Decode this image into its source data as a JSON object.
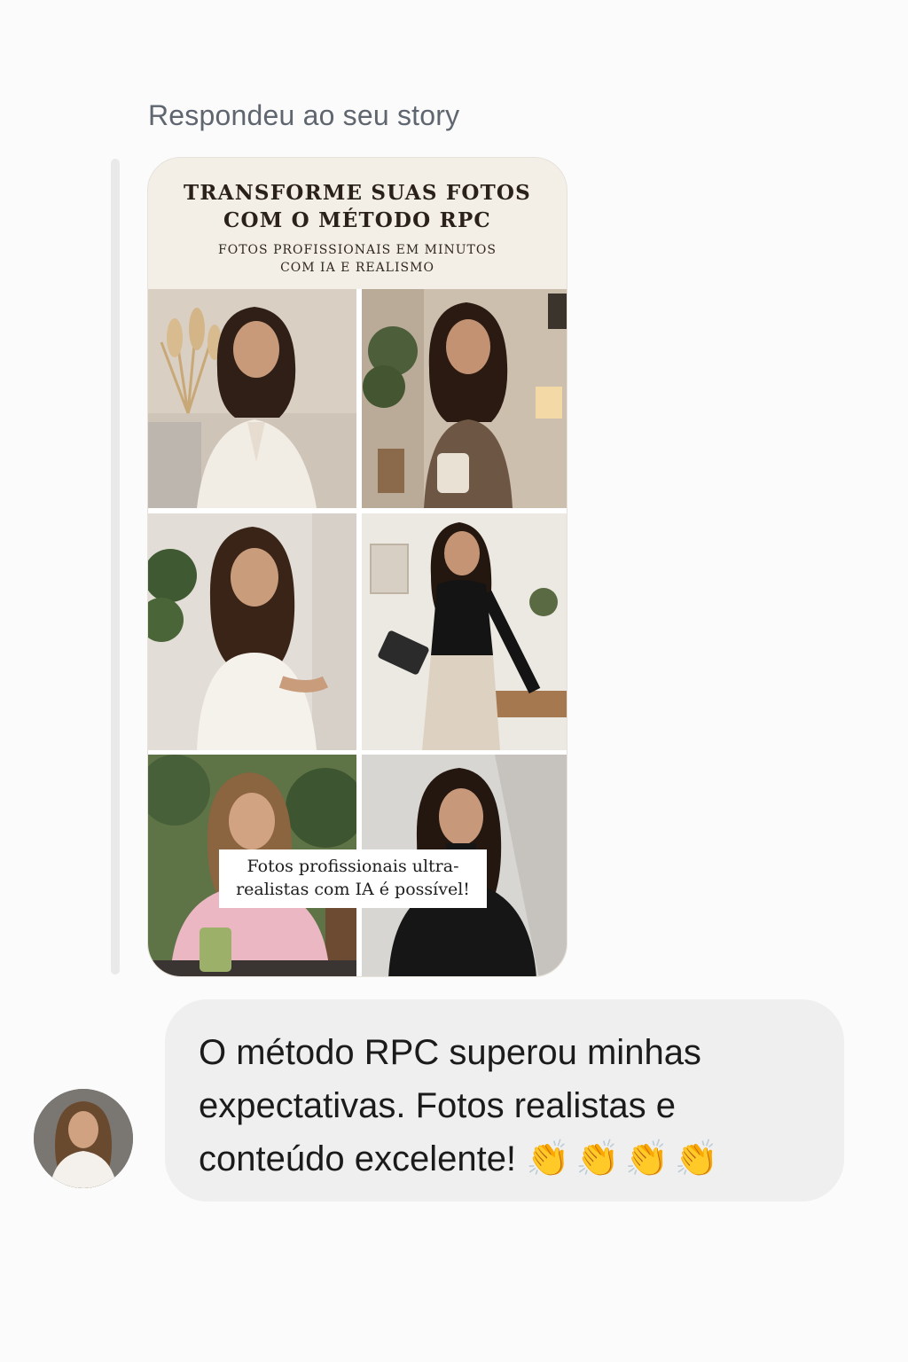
{
  "reply_label": "Respondeu ao seu story",
  "story": {
    "title_line1": "TRANSFORME SUAS FOTOS",
    "title_line2": "COM O MÉTODO RPC",
    "subtitle_line1": "FOTOS PROFISSIONAIS EM MINUTOS",
    "subtitle_line2": "COM IA E REALISMO",
    "caption_line1": "Fotos profissionais ultra-",
    "caption_line2": "realistas com IA é possível!"
  },
  "message": {
    "text": "O método RPC superou minhas expectativas. Fotos realistas e conteúdo excelente!",
    "emoji": "👏👏👏👏"
  },
  "colors": {
    "story_header_bg": "#f3eee6",
    "bubble_bg": "#efefef",
    "label_gray": "#5f6670"
  }
}
